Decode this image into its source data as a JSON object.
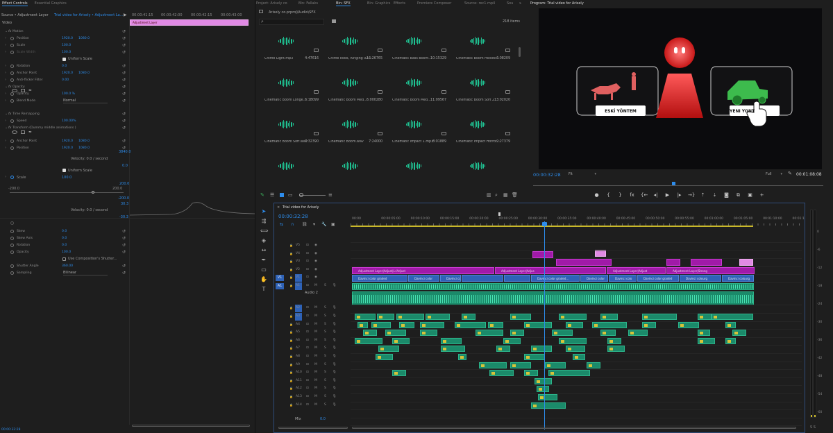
{
  "effect_controls": {
    "tabs": [
      "Effect Controls",
      "Essential Graphics"
    ],
    "source_label": "Source • Adjustment Layer",
    "sequence_label": "Trial video for Arisely • Adjustment La...",
    "times": [
      "00:00:41:15",
      "00:00:42:00",
      "00:00:42:15",
      "00:00:43:00"
    ],
    "clip_name": "Adjustment Layer",
    "video_label": "Video",
    "rows": [
      {
        "label": "Motion",
        "type": "section"
      },
      {
        "label": "Position",
        "v1": "1920.0",
        "v2": "1080.0"
      },
      {
        "label": "Scale",
        "v1": "100.0"
      },
      {
        "label": "Scale Width",
        "v1": "100.0",
        "dim": true
      },
      {
        "label": "Uniform Scale",
        "type": "check"
      },
      {
        "label": "Rotation",
        "v1": "0.0"
      },
      {
        "label": "Anchor Point",
        "v1": "1920.0",
        "v2": "1080.0"
      },
      {
        "label": "Anti-flicker Filter",
        "v1": "0.00"
      },
      {
        "label": "Opacity",
        "type": "section"
      },
      {
        "label": "Opacity",
        "v1": "100.0 %"
      },
      {
        "label": "Blend Mode",
        "v1": "Normal"
      },
      {
        "label": "Time Remapping",
        "type": "section"
      },
      {
        "label": "Speed",
        "v1": "100.00%"
      },
      {
        "label": "Transform (Dummy middle animations )",
        "type": "section"
      },
      {
        "label": "Anchor Point",
        "v1": "1920.0",
        "v2": "1080.0"
      },
      {
        "label": "Position",
        "v1": "1920.0",
        "v2": "1080.0"
      }
    ],
    "graph1_top": "3840.0",
    "graph1_bottom": "0.0",
    "velocity1": "Velocity: 0.0 / second",
    "uniform_scale": "Uniform Scale",
    "scale_label": "Scale",
    "scale_value": "100.0",
    "graph2_top": "200.0",
    "graph2_left": "-200.0",
    "graph2_right": "200.0",
    "graph2_bottom": "-200.0",
    "graph3_top": "30.3",
    "graph3_bottom": "-30.3",
    "velocity2": "Velocity: 0.0 / second",
    "rows2": [
      {
        "label": "Skew",
        "v1": "0.0"
      },
      {
        "label": "Skew Axis",
        "v1": "0.0"
      },
      {
        "label": "Rotation",
        "v1": "0.0"
      },
      {
        "label": "Opacity",
        "v1": "100.0"
      },
      {
        "label": "Use Composition's Shutter...",
        "type": "check"
      },
      {
        "label": "Shutter Angle",
        "v1": "360.00"
      },
      {
        "label": "Sampling",
        "v1": "Bilinear"
      }
    ],
    "current_time": "00:00:32:28"
  },
  "project": {
    "tabs": [
      "Project: Arisely co",
      "Bin: Fallaks",
      "Bin: SFX",
      "Bin: Graphics",
      "Effects",
      "Premiere Composer",
      "Source: rec1.mp4",
      "Sou"
    ],
    "path": "Arisely co.prproj\\Audio\\SFX",
    "item_count": "218 items",
    "items": [
      {
        "name": "Chime Light.mp3",
        "dur": "4:47616"
      },
      {
        "name": "Chime Rods, Ringing 02...",
        "dur": "16:26765"
      },
      {
        "name": "Cinematic Bass Boom...",
        "dur": "10:15329"
      },
      {
        "name": "Cinematic Boom Hollow...",
        "dur": "6:08209"
      },
      {
        "name": "Cinematic Boom Longe...",
        "dur": "6:18099"
      },
      {
        "name": "Cinematic Boom Med...",
        "dur": "6:000280"
      },
      {
        "name": "Cinematic Boom Med...",
        "dur": "11:09567"
      },
      {
        "name": "Cinematic Boom Soft 2...",
        "dur": "13:02020"
      },
      {
        "name": "Cinematic Boom Soft.wav",
        "dur": "7:32390"
      },
      {
        "name": "Cinematic Boom.wav",
        "dur": "7:24000"
      },
      {
        "name": "Cinematic Impact 1.mp3",
        "dur": "8:01889"
      },
      {
        "name": "Cinematic Impact Horror...",
        "dur": "2:27379"
      },
      {
        "name": "",
        "dur": ""
      },
      {
        "name": "",
        "dur": ""
      },
      {
        "name": "",
        "dur": ""
      },
      {
        "name": "",
        "dur": ""
      }
    ]
  },
  "program": {
    "title": "Program: Trial video for Arisely",
    "timecode": "00:00:32:28",
    "fit": "Fit",
    "quality": "Full",
    "duration": "00:01:08:08",
    "left_card_label": "ESKİ YÖNTEM",
    "right_card_label": "YENİ YÖNTEM"
  },
  "timeline": {
    "title": "Trial video for Arisely",
    "timecode": "00:00:32:28",
    "ruler": [
      "00:00",
      "00:00:05:00",
      "00:00:10:00",
      "00:00:15:00",
      "00:00:20:00",
      "00:00:25:00",
      "00:00:30:00",
      "00:00:35:00",
      "00:00:40:00",
      "00:00:45:00",
      "00:00:50:00",
      "00:00:55:00",
      "00:01:00:00",
      "00:01:05:00",
      "00:01:10:00",
      "00:01:15"
    ],
    "video_tracks": [
      "V5",
      "V4",
      "V3",
      "V2",
      "V1"
    ],
    "audio_tracks": [
      "A1",
      "A2",
      "A3",
      "A4",
      "A5",
      "A6",
      "A7",
      "A8",
      "A9",
      "A10",
      "A11",
      "A12",
      "A13",
      "A14"
    ],
    "audio2_name": "Audio 2",
    "mix_label": "Mix",
    "mix_value": "0.0",
    "clip_labels": {
      "adj1": "Adjustment Layer|Adjust|L:/Adjust",
      "adj2": "Adjustment Layer|Adjus",
      "adj3": "Adjustment Layer|Adjust",
      "adj4": "Adjustment Layer|Strong",
      "v1a": "Davinci color graded",
      "v1b": "Davinci color graded...",
      "v1c": "Davinci color",
      "v1d": "Davinci colo",
      "v1e": "Davinci color graded",
      "v1f": "Davinci colourg",
      "v1g": "Davinci colourg"
    }
  },
  "meter": {
    "labels": [
      "0",
      "-6",
      "-12",
      "-18",
      "-24",
      "-30",
      "-36",
      "-42",
      "-48",
      "-54",
      "-60"
    ],
    "foot": "S S"
  },
  "colors": {
    "accent": "#2d8ceb",
    "audio": "#1b8a6a",
    "video": "#2e62b7",
    "adjustment": "#a01aa8",
    "ruler_playhead": "#2d8ceb"
  }
}
